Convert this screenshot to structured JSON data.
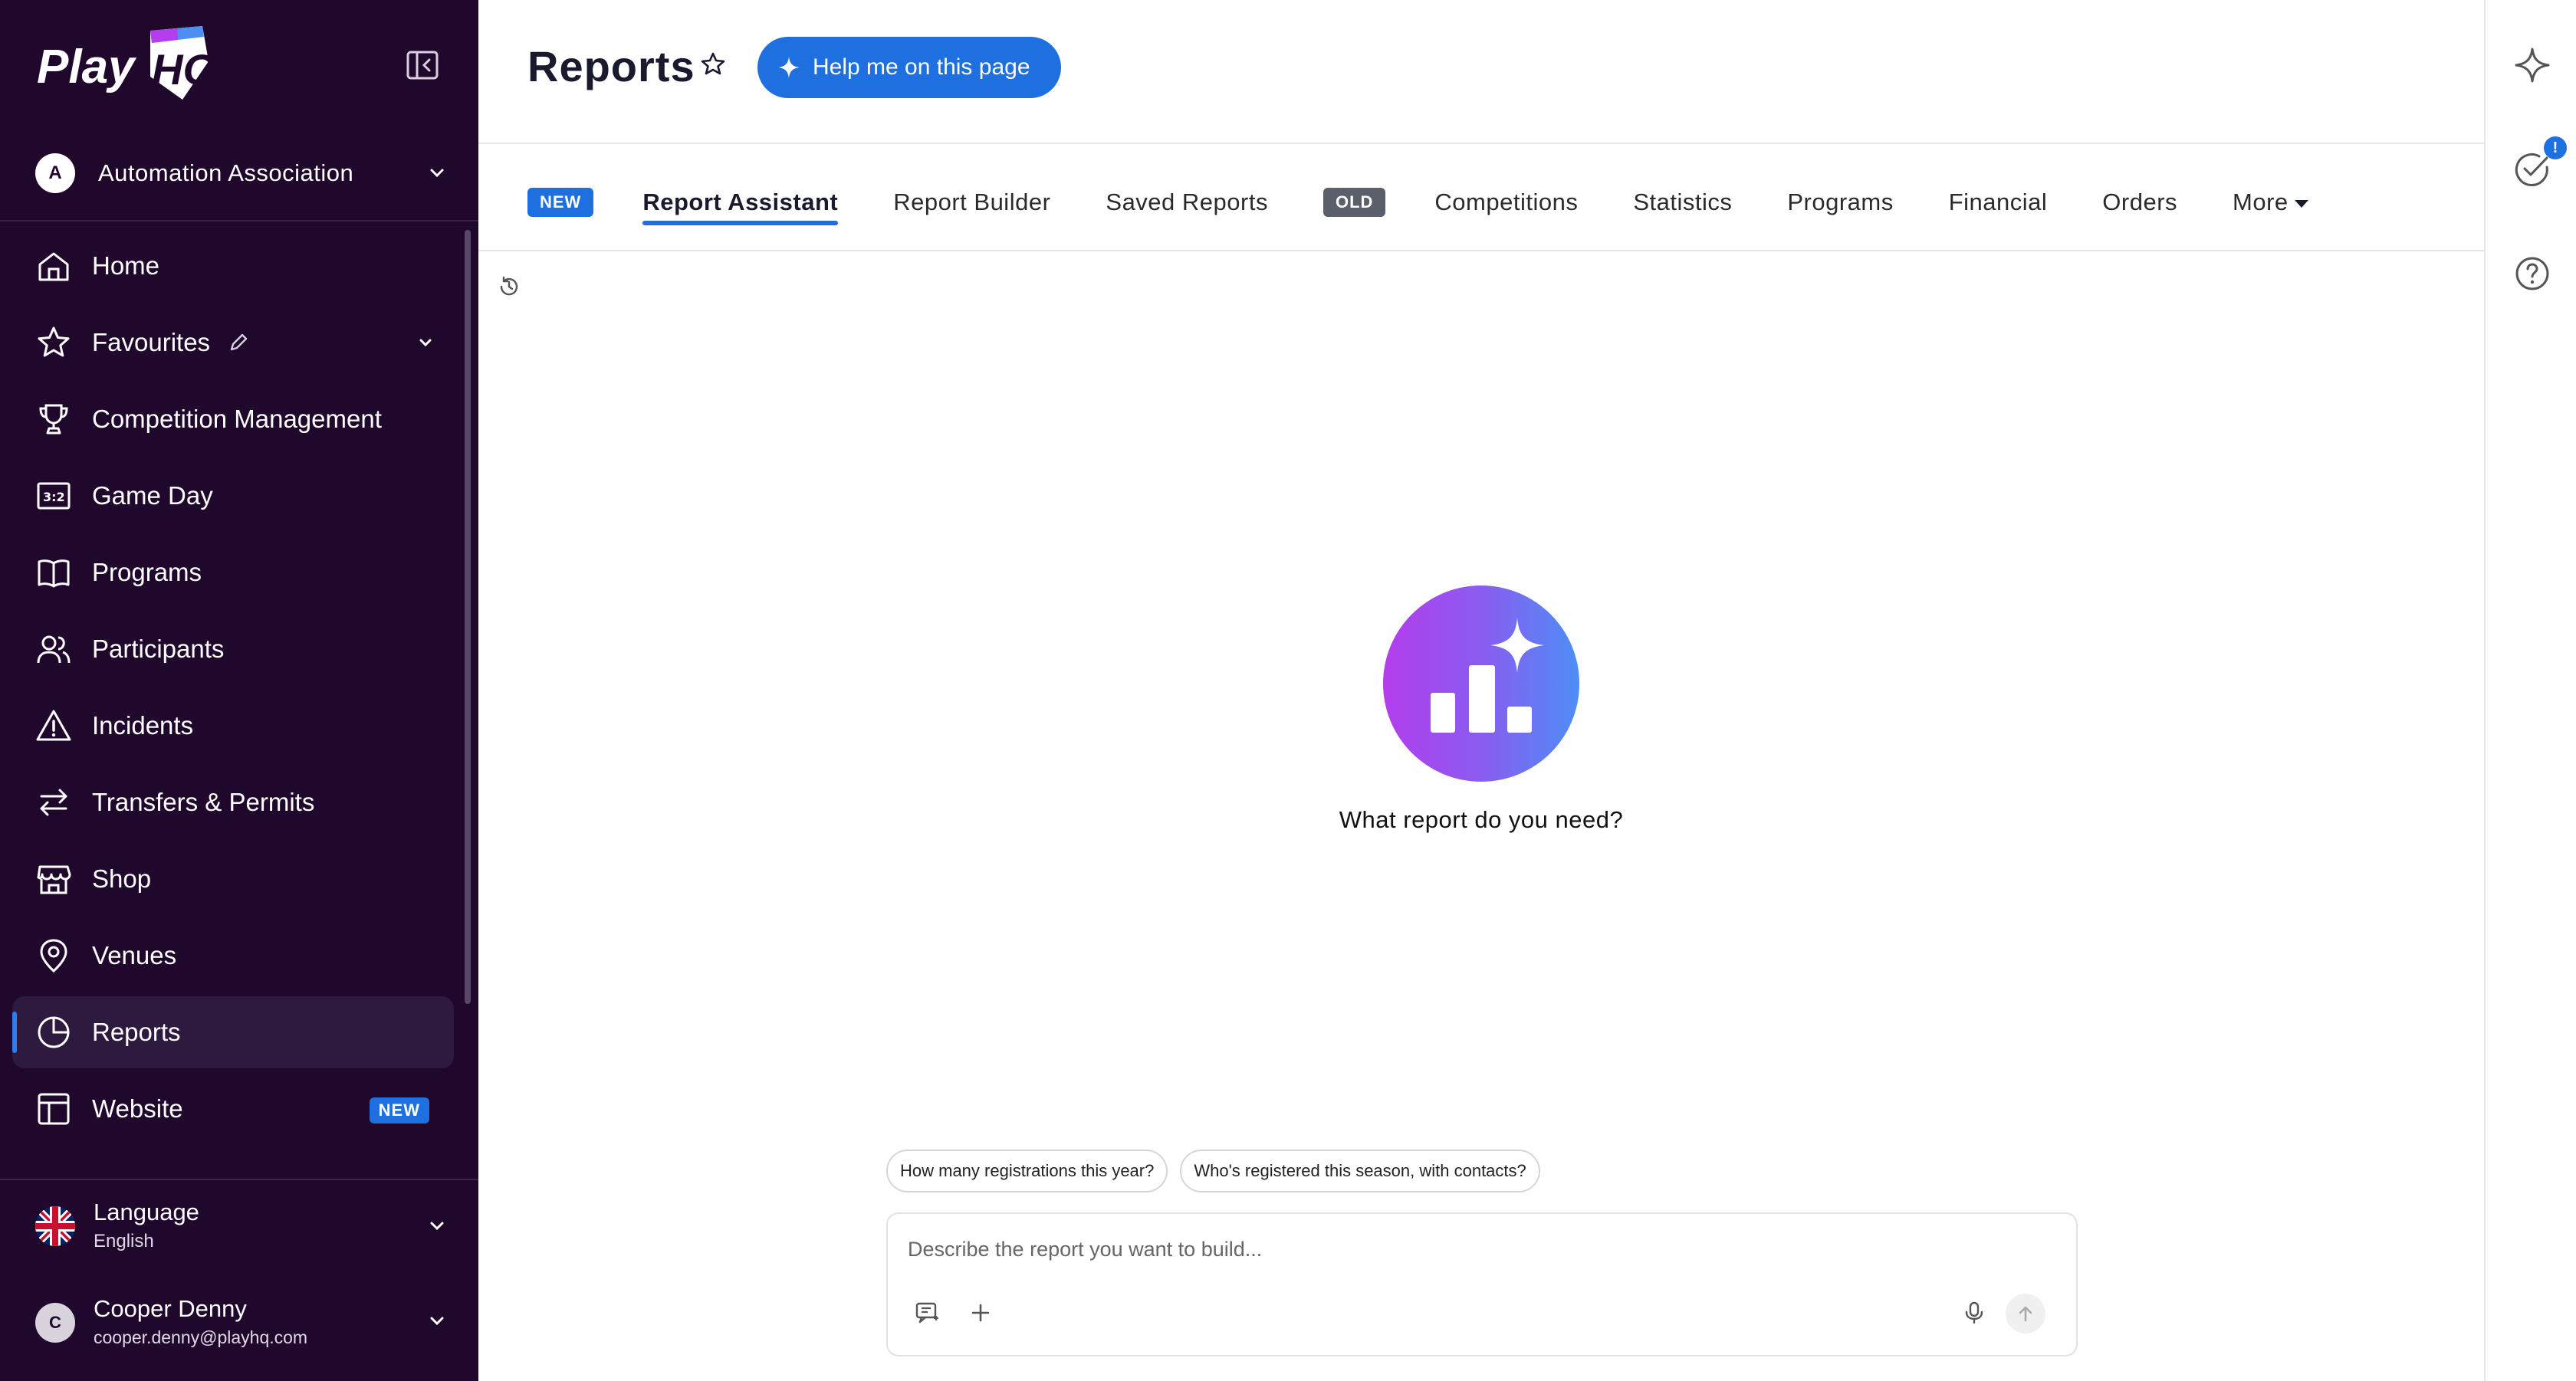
{
  "brand": {
    "logo_text": "PlayHQ"
  },
  "organisation": {
    "initial": "A",
    "name": "Automation Association"
  },
  "sidebar": {
    "items": [
      {
        "label": "Home",
        "icon": "home-icon"
      },
      {
        "label": "Favourites",
        "icon": "star-icon"
      },
      {
        "label": "Competition Management",
        "icon": "trophy-icon"
      },
      {
        "label": "Game Day",
        "icon": "scoreboard-icon"
      },
      {
        "label": "Programs",
        "icon": "book-icon"
      },
      {
        "label": "Participants",
        "icon": "people-icon"
      },
      {
        "label": "Incidents",
        "icon": "warning-icon"
      },
      {
        "label": "Transfers & Permits",
        "icon": "transfer-icon"
      },
      {
        "label": "Shop",
        "icon": "shop-icon"
      },
      {
        "label": "Venues",
        "icon": "location-pin-icon"
      },
      {
        "label": "Reports",
        "icon": "pie-chart-icon",
        "active": true
      },
      {
        "label": "Website",
        "icon": "layout-icon",
        "badge": "NEW"
      }
    ],
    "language": {
      "title": "Language",
      "value": "English"
    },
    "user": {
      "initial": "C",
      "name": "Cooper Denny",
      "email": "cooper.denny@playhq.com"
    }
  },
  "header": {
    "title": "Reports",
    "help_button": "Help me on this page"
  },
  "tabs": {
    "new_badge": "NEW",
    "old_badge": "OLD",
    "report_assistant": "Report Assistant",
    "report_builder": "Report Builder",
    "saved_reports": "Saved Reports",
    "competitions": "Competitions",
    "statistics": "Statistics",
    "programs": "Programs",
    "financial": "Financial",
    "orders": "Orders",
    "more": "More"
  },
  "assistant": {
    "prompt_heading": "What report do you need?",
    "suggestions": [
      "How many registrations this year?",
      "Who's registered this season, with contacts?"
    ],
    "input_placeholder": "Describe the report you want to build...",
    "input_value": ""
  },
  "rail": {
    "notification_count": "!"
  },
  "colors": {
    "sidebar_bg": "#20082d",
    "accent": "#1e6fe0",
    "hero_gradient_start": "#b43ded",
    "hero_gradient_end": "#4d8ef5",
    "old_badge": "#5a5f6a"
  }
}
